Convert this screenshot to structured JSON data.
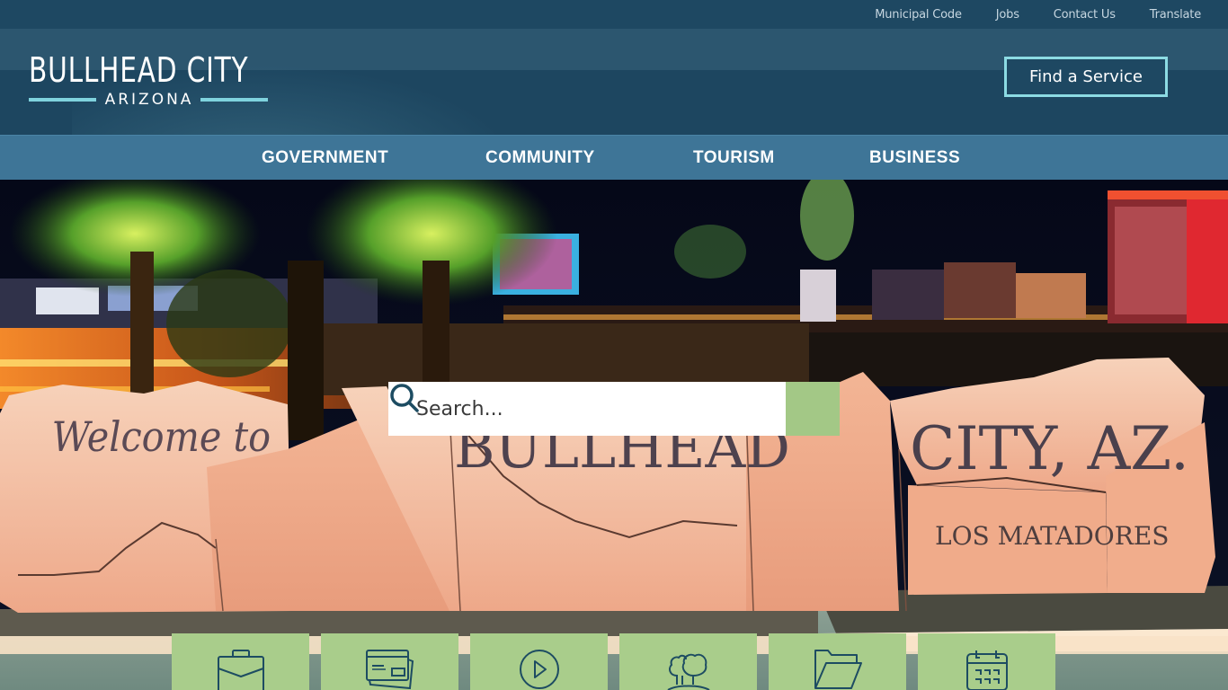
{
  "utility_nav": {
    "links": [
      "Municipal Code",
      "Jobs",
      "Contact Us",
      "Translate"
    ]
  },
  "header": {
    "logo_title": "BULLHEAD CITY",
    "logo_subtitle": "ARIZONA",
    "find_service_label": "Find a Service"
  },
  "main_nav": {
    "items": [
      "GOVERNMENT",
      "COMMUNITY",
      "TOURISM",
      "BUSINESS"
    ]
  },
  "hero": {
    "sign_text": {
      "welcome": "Welcome to",
      "city": "BULLHEAD",
      "state": "CITY, AZ.",
      "plaque": "LOS MATADORES"
    },
    "search": {
      "placeholder": "Search...",
      "button_icon": "search-icon"
    }
  },
  "quick_links": {
    "icons": [
      "briefcase-icon",
      "credit-card-icon",
      "play-icon",
      "trees-icon",
      "folder-icon",
      "calendar-icon"
    ]
  },
  "colors": {
    "utility_bar": "#1e4862",
    "header_bg": "#1d4660",
    "header_band": "#2c566f",
    "nav_bg": "#3e7597",
    "accent_cyan": "#8cdbe3",
    "tile_green": "#a9cd8b",
    "icon_navy": "#1d4c62"
  }
}
